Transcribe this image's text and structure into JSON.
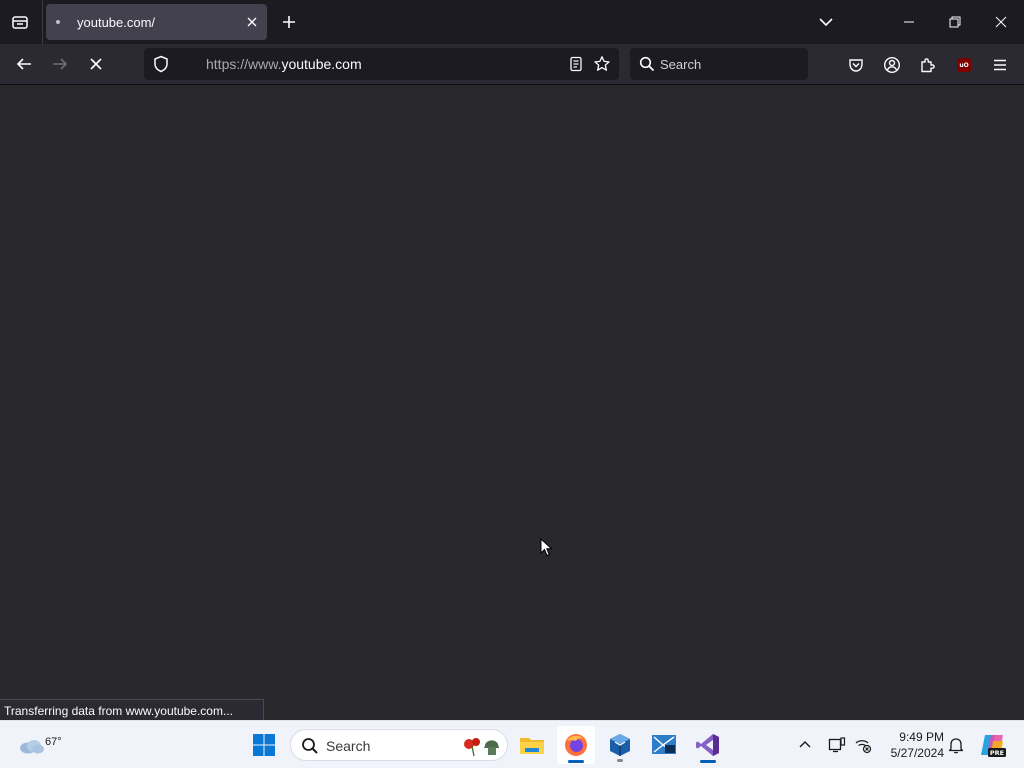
{
  "browser": {
    "tab": {
      "title": "youtube.com/"
    },
    "url": {
      "scheme": "https://www.",
      "host": "youtube.com"
    },
    "search": {
      "placeholder": "Search"
    },
    "toolbar": {
      "ublock_badge": "uO"
    },
    "status": "Transferring data from www.youtube.com..."
  },
  "taskbar": {
    "weather": {
      "temp": "67°"
    },
    "search": {
      "placeholder": "Search"
    },
    "apps": [
      {
        "name": "File Explorer",
        "icon": "folder-icon"
      },
      {
        "name": "Firefox",
        "icon": "firefox-icon",
        "active": true
      },
      {
        "name": "VirtualBox",
        "icon": "virtualbox-icon"
      },
      {
        "name": "Network tool",
        "icon": "network-app-icon"
      },
      {
        "name": "Visual Studio",
        "icon": "visual-studio-icon"
      }
    ],
    "clock": {
      "time": "9:49 PM",
      "date": "5/27/2024"
    },
    "copilot_badge": "PRE"
  },
  "colors": {
    "tab_strip": "#1c1b22",
    "toolbar": "#2b2a33",
    "active_tab": "#42414d",
    "page_background": "#28282d",
    "taskbar": "#f0f3f9",
    "accent": "#005fb8"
  }
}
